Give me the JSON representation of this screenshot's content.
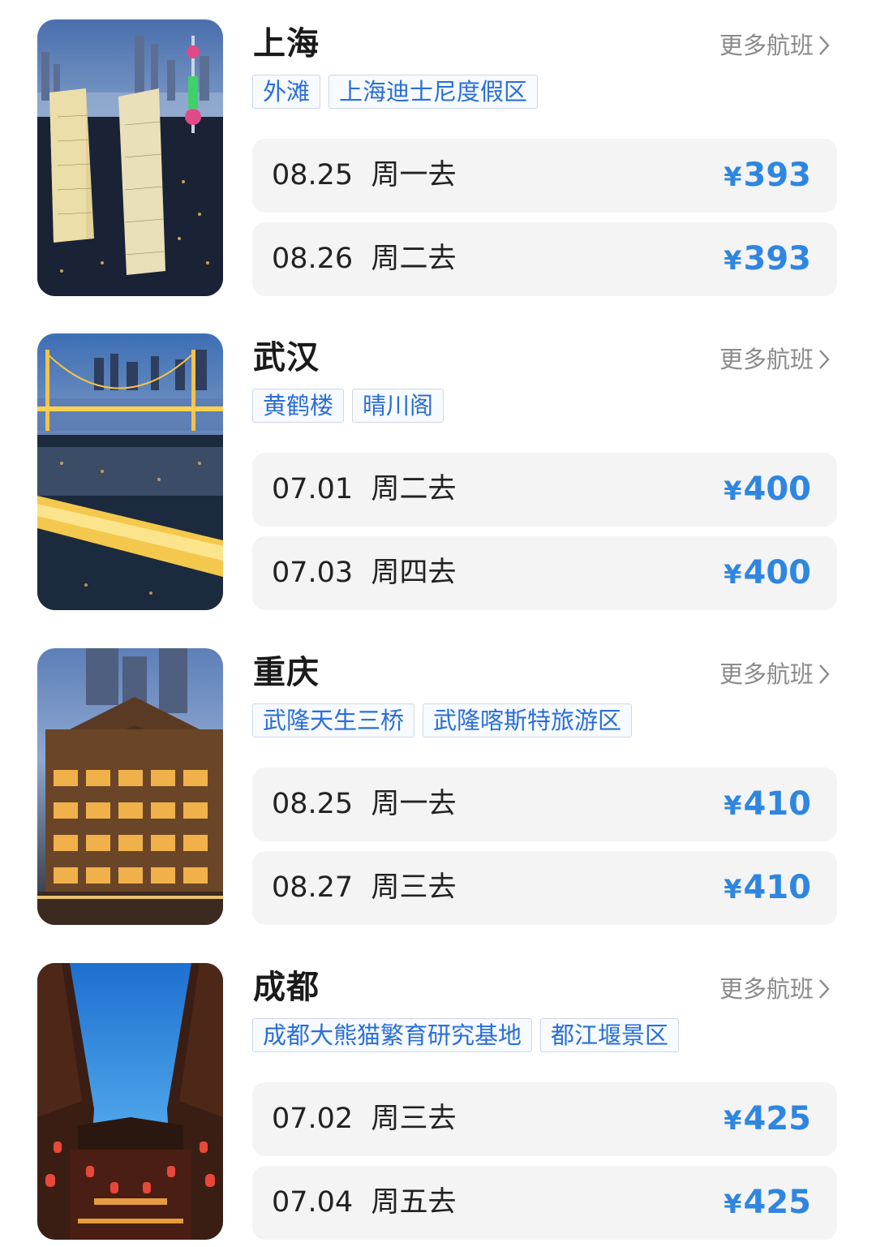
{
  "colors": {
    "accent": "#2e86e0",
    "tag_text": "#2a6fd6",
    "row_bg": "#f4f4f5",
    "muted": "#8a8a8a"
  },
  "more_label": "更多航班",
  "destinations": [
    {
      "city": "上海",
      "image": "shanghai-skyline-night-photo",
      "tags": [
        "外滩",
        "上海迪士尼度假区"
      ],
      "flights": [
        {
          "date": "08.25",
          "day": "周一去",
          "currency": "¥",
          "price": "393"
        },
        {
          "date": "08.26",
          "day": "周二去",
          "currency": "¥",
          "price": "393"
        }
      ]
    },
    {
      "city": "武汉",
      "image": "wuhan-bridge-night-photo",
      "tags": [
        "黄鹤楼",
        "晴川阁"
      ],
      "flights": [
        {
          "date": "07.01",
          "day": "周二去",
          "currency": "¥",
          "price": "400"
        },
        {
          "date": "07.03",
          "day": "周四去",
          "currency": "¥",
          "price": "400"
        }
      ]
    },
    {
      "city": "重庆",
      "image": "chongqing-hongyadong-night-photo",
      "tags": [
        "武隆天生三桥",
        "武隆喀斯特旅游区"
      ],
      "flights": [
        {
          "date": "08.25",
          "day": "周一去",
          "currency": "¥",
          "price": "410"
        },
        {
          "date": "08.27",
          "day": "周三去",
          "currency": "¥",
          "price": "410"
        }
      ]
    },
    {
      "city": "成都",
      "image": "chengdu-ancient-street-photo",
      "tags": [
        "成都大熊猫繁育研究基地",
        "都江堰景区"
      ],
      "flights": [
        {
          "date": "07.02",
          "day": "周三去",
          "currency": "¥",
          "price": "425"
        },
        {
          "date": "07.04",
          "day": "周五去",
          "currency": "¥",
          "price": "425"
        }
      ]
    }
  ]
}
